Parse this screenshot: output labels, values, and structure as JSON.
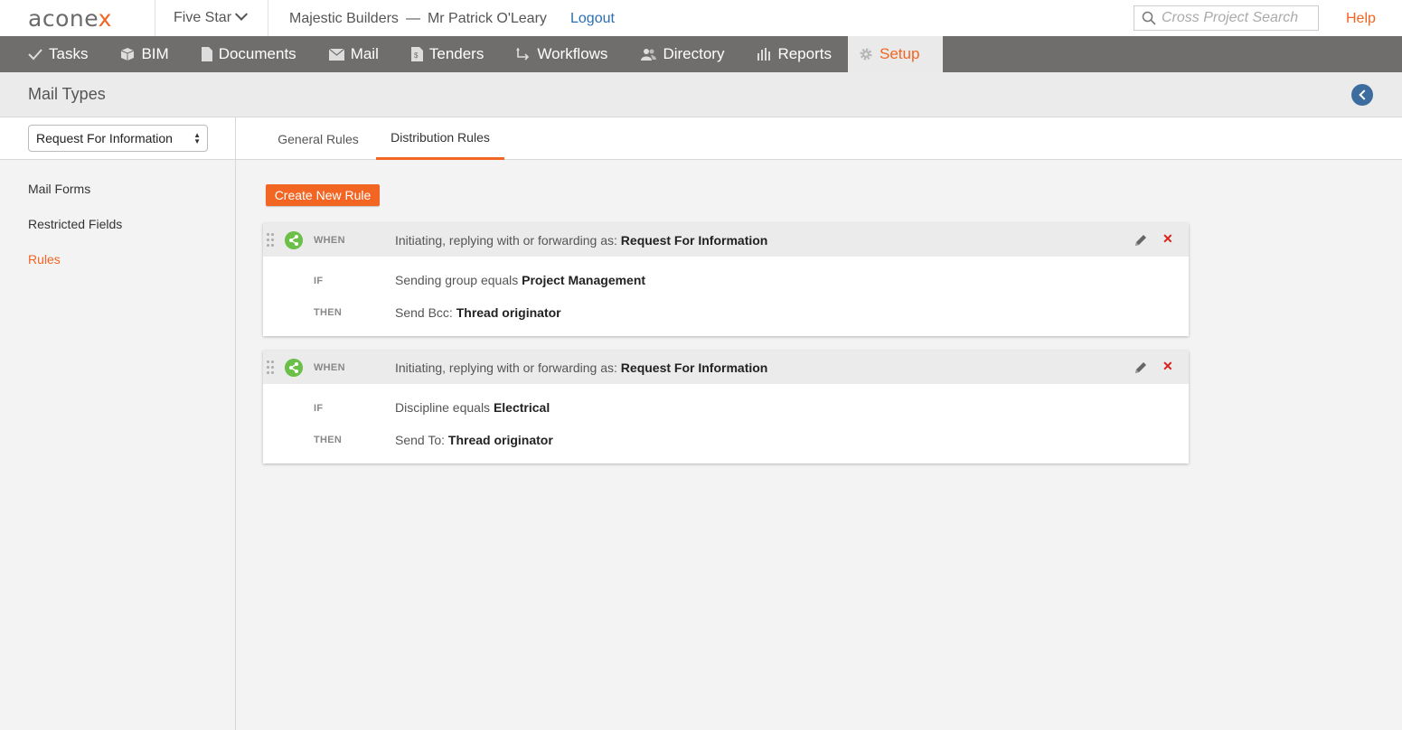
{
  "brand": {
    "logo_main": "acone",
    "logo_accent": "x"
  },
  "topbar": {
    "project": "Five Star",
    "organization": "Majestic Builders",
    "separator": "—",
    "user": "Mr Patrick O'Leary",
    "logout": "Logout",
    "search_placeholder": "Cross Project Search",
    "help": "Help"
  },
  "nav": {
    "items": [
      {
        "label": "Tasks",
        "icon": "check-icon"
      },
      {
        "label": "BIM",
        "icon": "cube-icon"
      },
      {
        "label": "Documents",
        "icon": "document-icon"
      },
      {
        "label": "Mail",
        "icon": "envelope-icon"
      },
      {
        "label": "Tenders",
        "icon": "tender-icon"
      },
      {
        "label": "Workflows",
        "icon": "workflow-icon"
      },
      {
        "label": "Directory",
        "icon": "people-icon"
      },
      {
        "label": "Reports",
        "icon": "bar-chart-icon"
      },
      {
        "label": "Setup",
        "icon": "gear-icon",
        "active": true
      }
    ]
  },
  "page": {
    "title": "Mail Types"
  },
  "sidebar": {
    "mail_type_selected": "Request For Information",
    "links": [
      "Mail Forms",
      "Restricted Fields",
      "Rules"
    ],
    "active_link": "Rules"
  },
  "tabs": [
    "General Rules",
    "Distribution Rules"
  ],
  "active_tab": "Distribution Rules",
  "actions": {
    "create_rule": "Create New Rule"
  },
  "rules": [
    {
      "when_kw": "WHEN",
      "when_text": "Initiating, replying with or forwarding as:",
      "when_value": "Request For Information",
      "if_kw": "IF",
      "if_text": "Sending group equals",
      "if_value": "Project Management",
      "then_kw": "THEN",
      "then_text": "Send Bcc:",
      "then_value": "Thread originator"
    },
    {
      "when_kw": "WHEN",
      "when_text": "Initiating, replying with or forwarding as:",
      "when_value": "Request For Information",
      "if_kw": "IF",
      "if_text": "Discipline equals",
      "if_value": "Electrical",
      "then_kw": "THEN",
      "then_text": "Send To:",
      "then_value": "Thread originator"
    }
  ],
  "colors": {
    "accent": "#f26522",
    "nav_bg": "#6f6e6c",
    "link": "#2a6fb3",
    "rule_icon": "#6cc04a",
    "delete": "#d9211b",
    "back_button": "#3c6d9e"
  }
}
